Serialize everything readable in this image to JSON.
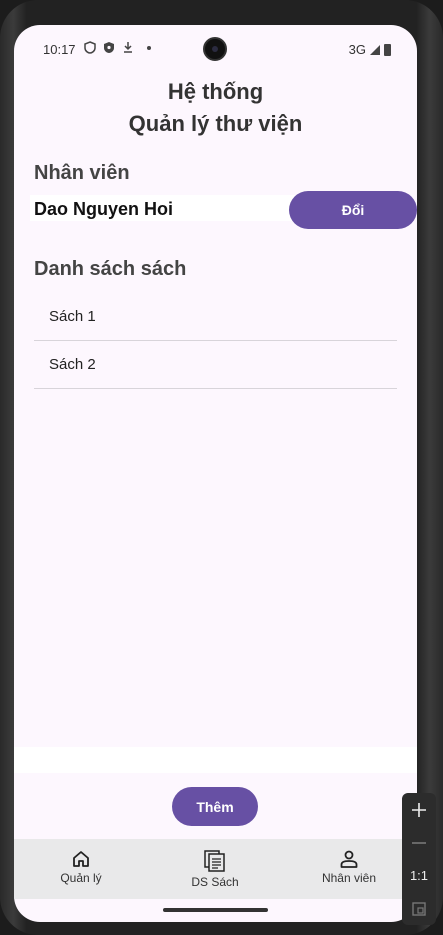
{
  "status_bar": {
    "time": "10:17",
    "network": "3G"
  },
  "header": {
    "title_line1": "Hệ thống",
    "title_line2": "Quản lý thư viện"
  },
  "staff": {
    "label": "Nhân viên",
    "name": "Dao Nguyen Hoi",
    "change_label": "Đổi"
  },
  "books": {
    "label": "Danh sách sách",
    "items": [
      "Sách 1",
      "Sách 2"
    ]
  },
  "add_label": "Thêm",
  "bottom_nav": {
    "items": [
      {
        "label": "Quản lý",
        "icon": "home-icon"
      },
      {
        "label": "DS Sách",
        "icon": "book-list-icon"
      },
      {
        "label": "Nhân viên",
        "icon": "person-icon"
      }
    ]
  },
  "side_controls": {
    "zoom_label": "1:1"
  },
  "colors": {
    "accent": "#6750a4",
    "background": "#fdf7fe",
    "nav_bg": "#e9e9ea"
  }
}
